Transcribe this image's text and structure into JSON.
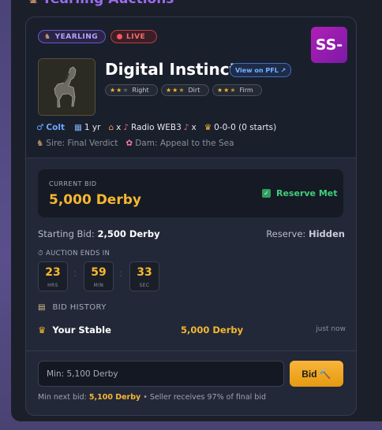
{
  "page": {
    "title": "Yearling Auctions",
    "title_icon": "horse-emoji"
  },
  "listing": {
    "badges": {
      "yearling": "YEARLING",
      "live": "LIVE"
    },
    "logo_text": "SS-",
    "horse_name": "Digital Instinct",
    "pfl_link": "View on PFL ↗",
    "traits": [
      {
        "stars": 2,
        "max": 3,
        "label": "Right"
      },
      {
        "stars": 2.5,
        "max": 3,
        "label": "Dirt"
      },
      {
        "stars": 2.5,
        "max": 3,
        "label": "Firm"
      }
    ],
    "gender": "Colt",
    "age": "1 yr",
    "breeding_x1": "x",
    "stable_label": "Radio WEB3",
    "breeding_x2": "x",
    "record": "0-0-0 (0 starts)",
    "sire": "Sire: Final Verdict",
    "dam": "Dam: Appeal to the Sea"
  },
  "bid": {
    "current_label": "CURRENT BID",
    "current_value": "5,000 Derby",
    "reserve_status": "Reserve Met",
    "starting_label": "Starting Bid:",
    "starting_value": "2,500 Derby",
    "reserve_label": "Reserve:",
    "reserve_value": "Hidden"
  },
  "timer": {
    "label": "AUCTION ENDS IN",
    "hours": "23",
    "hours_unit": "HRS",
    "minutes": "59",
    "minutes_unit": "MIN",
    "seconds": "33",
    "seconds_unit": "SEC"
  },
  "history": {
    "label": "BID HISTORY",
    "rows": [
      {
        "who": "Your Stable",
        "amount": "5,000 Derby",
        "time": "just now"
      }
    ]
  },
  "form": {
    "placeholder": "Min: 5,100 Derby",
    "button": "Bid 🔨",
    "min_label": "Min next bid:",
    "min_value": "5,100 Derby",
    "note": "• Seller receives 97% of final bid"
  },
  "colors": {
    "accent": "#f5b731",
    "brand": "#9a6cf0",
    "success": "#3fcf7d",
    "live": "#ff5454"
  }
}
